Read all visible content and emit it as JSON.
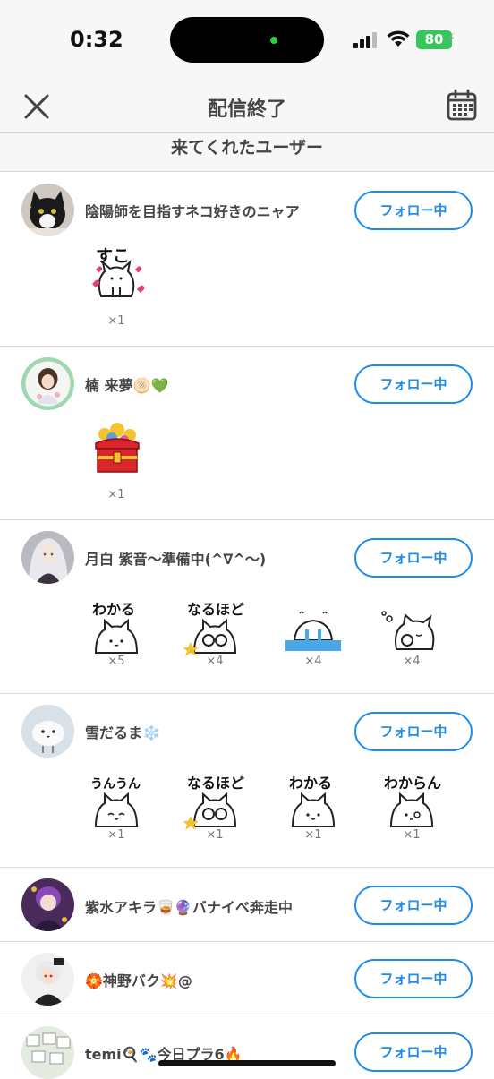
{
  "status": {
    "time": "0:32",
    "battery": "80"
  },
  "header": {
    "title": "配信終了"
  },
  "section": {
    "title": "来てくれたユーザー"
  },
  "follow_label": "フォロー中",
  "users": [
    {
      "name": "陰陽師を目指すネコ好きのニャア",
      "stamps": [
        {
          "label": "すこ",
          "count": "×1"
        }
      ]
    },
    {
      "name": "楠 来夢🫓💚",
      "stamps": [
        {
          "label": "",
          "count": "×1"
        }
      ]
    },
    {
      "name": "月白 紫音〜準備中(^∇^〜)",
      "stamps": [
        {
          "label": "わかる",
          "count": "×5"
        },
        {
          "label": "なるほど",
          "count": "×4"
        },
        {
          "label": "",
          "count": "×4"
        },
        {
          "label": "",
          "count": "×4"
        }
      ]
    },
    {
      "name": "雪だるま❄️",
      "stamps": [
        {
          "label": "うんうん",
          "count": "×1"
        },
        {
          "label": "なるほど",
          "count": "×1"
        },
        {
          "label": "わかる",
          "count": "×1"
        },
        {
          "label": "わからん",
          "count": "×1"
        }
      ]
    },
    {
      "name": "紫水アキラ🥃🔮バナイベ奔走中",
      "stamps": []
    },
    {
      "name": "🏵️神野バク💥@",
      "stamps": []
    },
    {
      "name": "temi🍳🐾今日プラ6🔥",
      "stamps": []
    }
  ],
  "colors": {
    "accent": "#1d8cf0",
    "battery": "#34c759"
  }
}
